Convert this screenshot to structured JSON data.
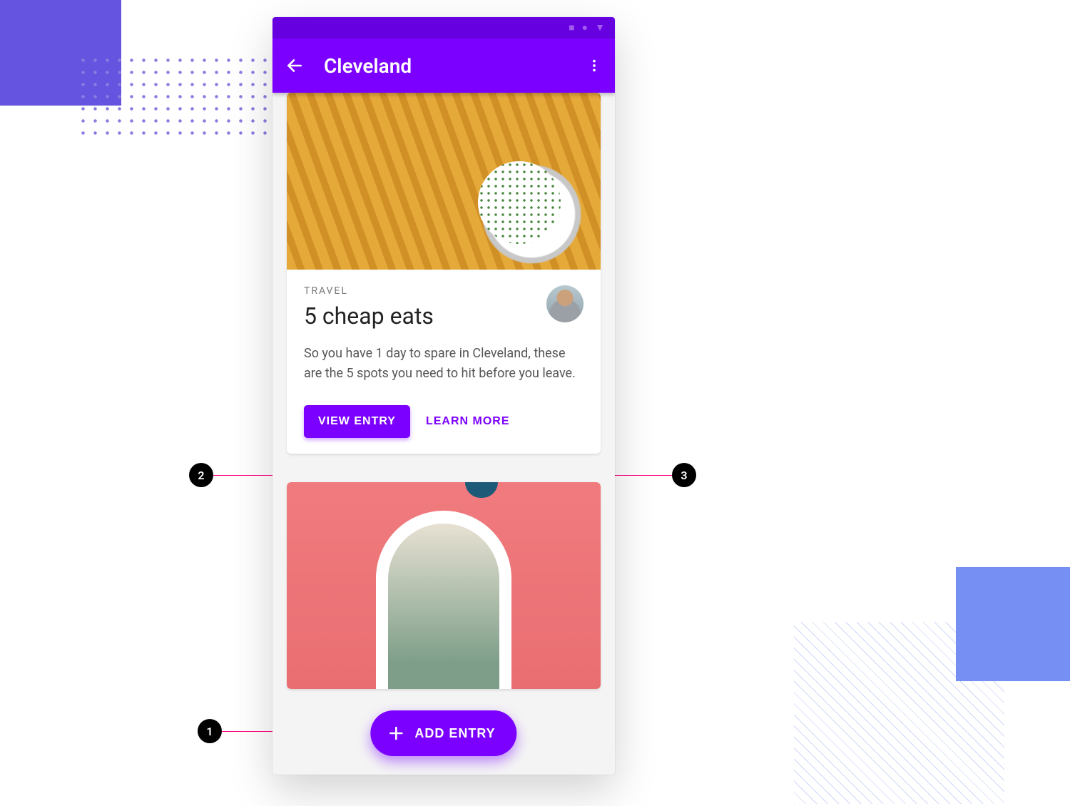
{
  "appbar": {
    "title": "Cleveland"
  },
  "card": {
    "category": "TRAVEL",
    "title": "5 cheap eats",
    "text": "So you have 1 day to spare in Cleveland, these are the 5 spots you need to hit before you leave.",
    "primary_action": "VIEW ENTRY",
    "secondary_action": "LEARN MORE"
  },
  "fab": {
    "label": "ADD ENTRY"
  },
  "callouts": {
    "fab": "1",
    "contained_button": "2",
    "text_button": "3"
  }
}
